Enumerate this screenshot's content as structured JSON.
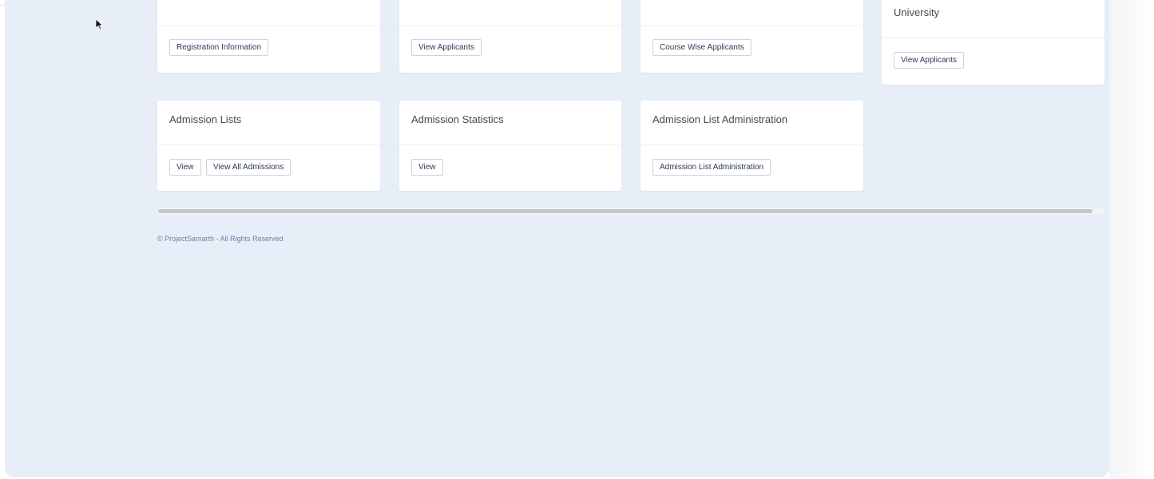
{
  "top_cards": [
    {
      "button": "Registration Information"
    },
    {
      "button": "View Applicants"
    },
    {
      "button": "Course Wise Applicants"
    },
    {
      "title_visible_line": "University",
      "button": "View Applicants"
    }
  ],
  "cards": [
    {
      "title": "Admission Lists",
      "buttons": [
        "View",
        "View All Admissions"
      ]
    },
    {
      "title": "Admission Statistics",
      "buttons": [
        "View"
      ]
    },
    {
      "title": "Admission List Administration",
      "buttons": [
        "Admission List Administration"
      ]
    }
  ],
  "footer": {
    "text": "© ProjectSamarth - All Rights Reserved"
  },
  "icons": {
    "cursor": "mouse-pointer-icon"
  }
}
